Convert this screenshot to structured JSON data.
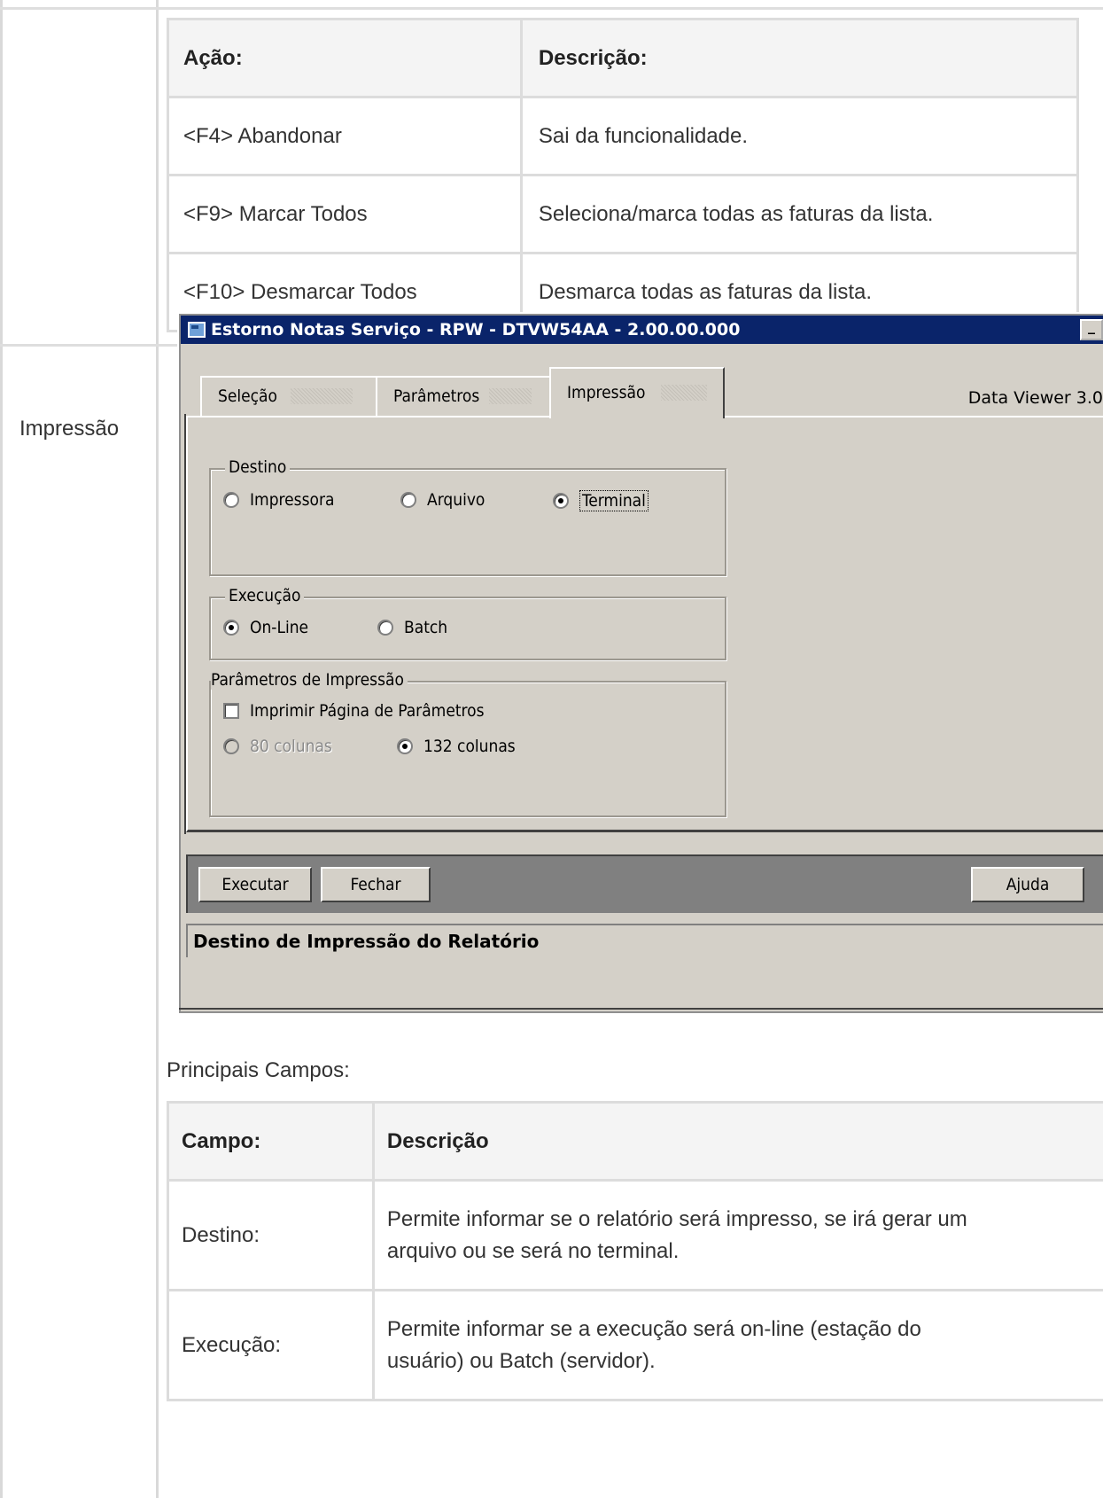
{
  "top_table": {
    "headers": [
      "Ação:",
      "Descrição:"
    ],
    "rows": [
      [
        "<F4> Abandonar",
        "Sai da funcionalidade."
      ],
      [
        "<F9> Marcar Todos",
        "Seleciona/marca todas as faturas da lista."
      ],
      [
        "<F10> Desmarcar Todos",
        "Desmarca todas as faturas da lista."
      ]
    ]
  },
  "row_label": "Impressão",
  "window": {
    "title": "Estorno Notas Serviço - RPW - DTVW54AA - 2.00.00.000",
    "minimize_glyph": "_",
    "tabs": [
      "Seleção",
      "Parâmetros",
      "Impressão"
    ],
    "active_tab": "Impressão",
    "data_viewer": "Data Viewer 3.0",
    "destino": {
      "title": "Destino",
      "options": [
        "Impressora",
        "Arquivo",
        "Terminal"
      ],
      "selected": "Terminal"
    },
    "execucao": {
      "title": "Execução",
      "options": [
        "On-Line",
        "Batch"
      ],
      "selected": "On-Line"
    },
    "parametros": {
      "title": "Parâmetros de Impressão",
      "checkbox_label": "Imprimir Página de Parâmetros",
      "checkbox_checked": false,
      "options": [
        "80 colunas",
        "132 colunas"
      ],
      "selected": "132 colunas",
      "disabled_option": "80 colunas"
    },
    "buttons": {
      "executar": "Executar",
      "fechar": "Fechar",
      "ajuda": "Ajuda"
    },
    "status": "Destino de Impressão do Relatório"
  },
  "principais_campos": "Principais Campos:",
  "fields_table": {
    "headers": [
      "Campo:",
      "Descrição"
    ],
    "rows": [
      [
        "Destino:",
        "Permite informar se o relatório será impresso, se irá gerar um",
        "arquivo ou se será no terminal."
      ],
      [
        "Execução:",
        "Permite informar se a execução será on-line (estação do",
        "usuário) ou Batch (servidor)."
      ]
    ]
  }
}
